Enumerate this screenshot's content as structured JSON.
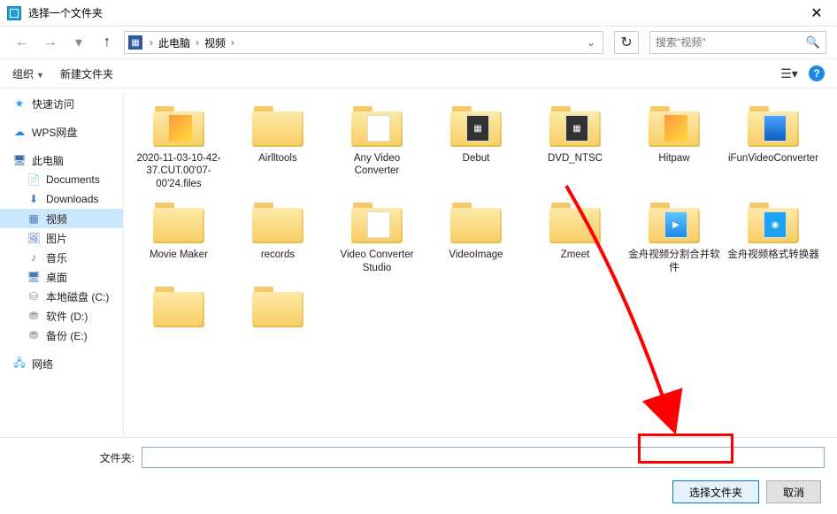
{
  "window": {
    "title": "选择一个文件夹",
    "close": "✕"
  },
  "nav": {
    "back": "←",
    "forward": "→",
    "up": "↑",
    "breadcrumb_items": [
      "此电脑",
      "视频"
    ],
    "dropdown": "⌄",
    "refresh": "↻"
  },
  "search": {
    "placeholder": "搜索\"视频\"",
    "icon": "🔍"
  },
  "toolbar": {
    "organize": "组织",
    "newfolder": "新建文件夹",
    "viewicon": "☰▾",
    "help": "?"
  },
  "sidebar": {
    "quickaccess": "快速访问",
    "wps": "WPS网盘",
    "thispc": "此电脑",
    "documents": "Documents",
    "downloads": "Downloads",
    "videos": "视频",
    "pictures": "图片",
    "music": "音乐",
    "desktop": "桌面",
    "localc": "本地磁盘 (C:)",
    "soft": "软件 (D:)",
    "backup": "备份 (E:)",
    "network": "网络"
  },
  "folders": [
    {
      "name": "2020-11-03-10-42-37.CUT.00'07-00'24.files",
      "thumb": "img"
    },
    {
      "name": "Airlltools",
      "thumb": "none"
    },
    {
      "name": "Any Video Converter",
      "thumb": "doc"
    },
    {
      "name": "Debut",
      "thumb": "vid"
    },
    {
      "name": "DVD_NTSC",
      "thumb": "vid"
    },
    {
      "name": "Hitpaw",
      "thumb": "img"
    },
    {
      "name": "iFunVideoConverter",
      "thumb": "desk"
    },
    {
      "name": "Movie Maker",
      "thumb": "none"
    },
    {
      "name": "records",
      "thumb": "none"
    },
    {
      "name": "Video Converter Studio",
      "thumb": "doc"
    },
    {
      "name": "VideoImage",
      "thumb": "none"
    },
    {
      "name": "Zmeet",
      "thumb": "none"
    },
    {
      "name": "金舟视频分割合并软件",
      "thumb": "play"
    },
    {
      "name": "金舟视频格式转换器",
      "thumb": "blue"
    },
    {
      "name": "",
      "thumb": "none"
    },
    {
      "name": "",
      "thumb": "none"
    }
  ],
  "footer": {
    "label": "文件夹:",
    "value": "",
    "select": "选择文件夹",
    "cancel": "取消"
  }
}
